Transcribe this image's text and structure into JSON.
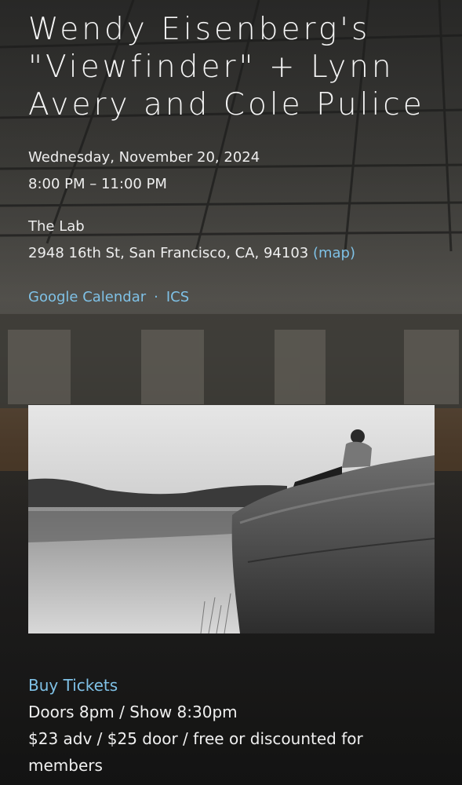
{
  "event": {
    "title": "Wendy Eisenberg's \"Viewfinder\" + Lynn Avery and Cole Pulice",
    "date": "Wednesday, November 20, 2024",
    "time": "8:00 PM – 11:00 PM",
    "venue_name": "The Lab",
    "address": "2948 16th St, San Francisco, CA, 94103",
    "map_label": "(map)"
  },
  "calendar": {
    "google": "Google Calendar",
    "separator": "·",
    "ics": "ICS"
  },
  "tickets": {
    "buy_label": "Buy Tickets",
    "doors": "Doors 8pm / Show 8:30pm",
    "pricing": "$23 adv / $25 door / free or discounted for members"
  },
  "colors": {
    "link": "#7fc1e6",
    "text": "#f2f2f2",
    "background": "#2e2e2d"
  }
}
